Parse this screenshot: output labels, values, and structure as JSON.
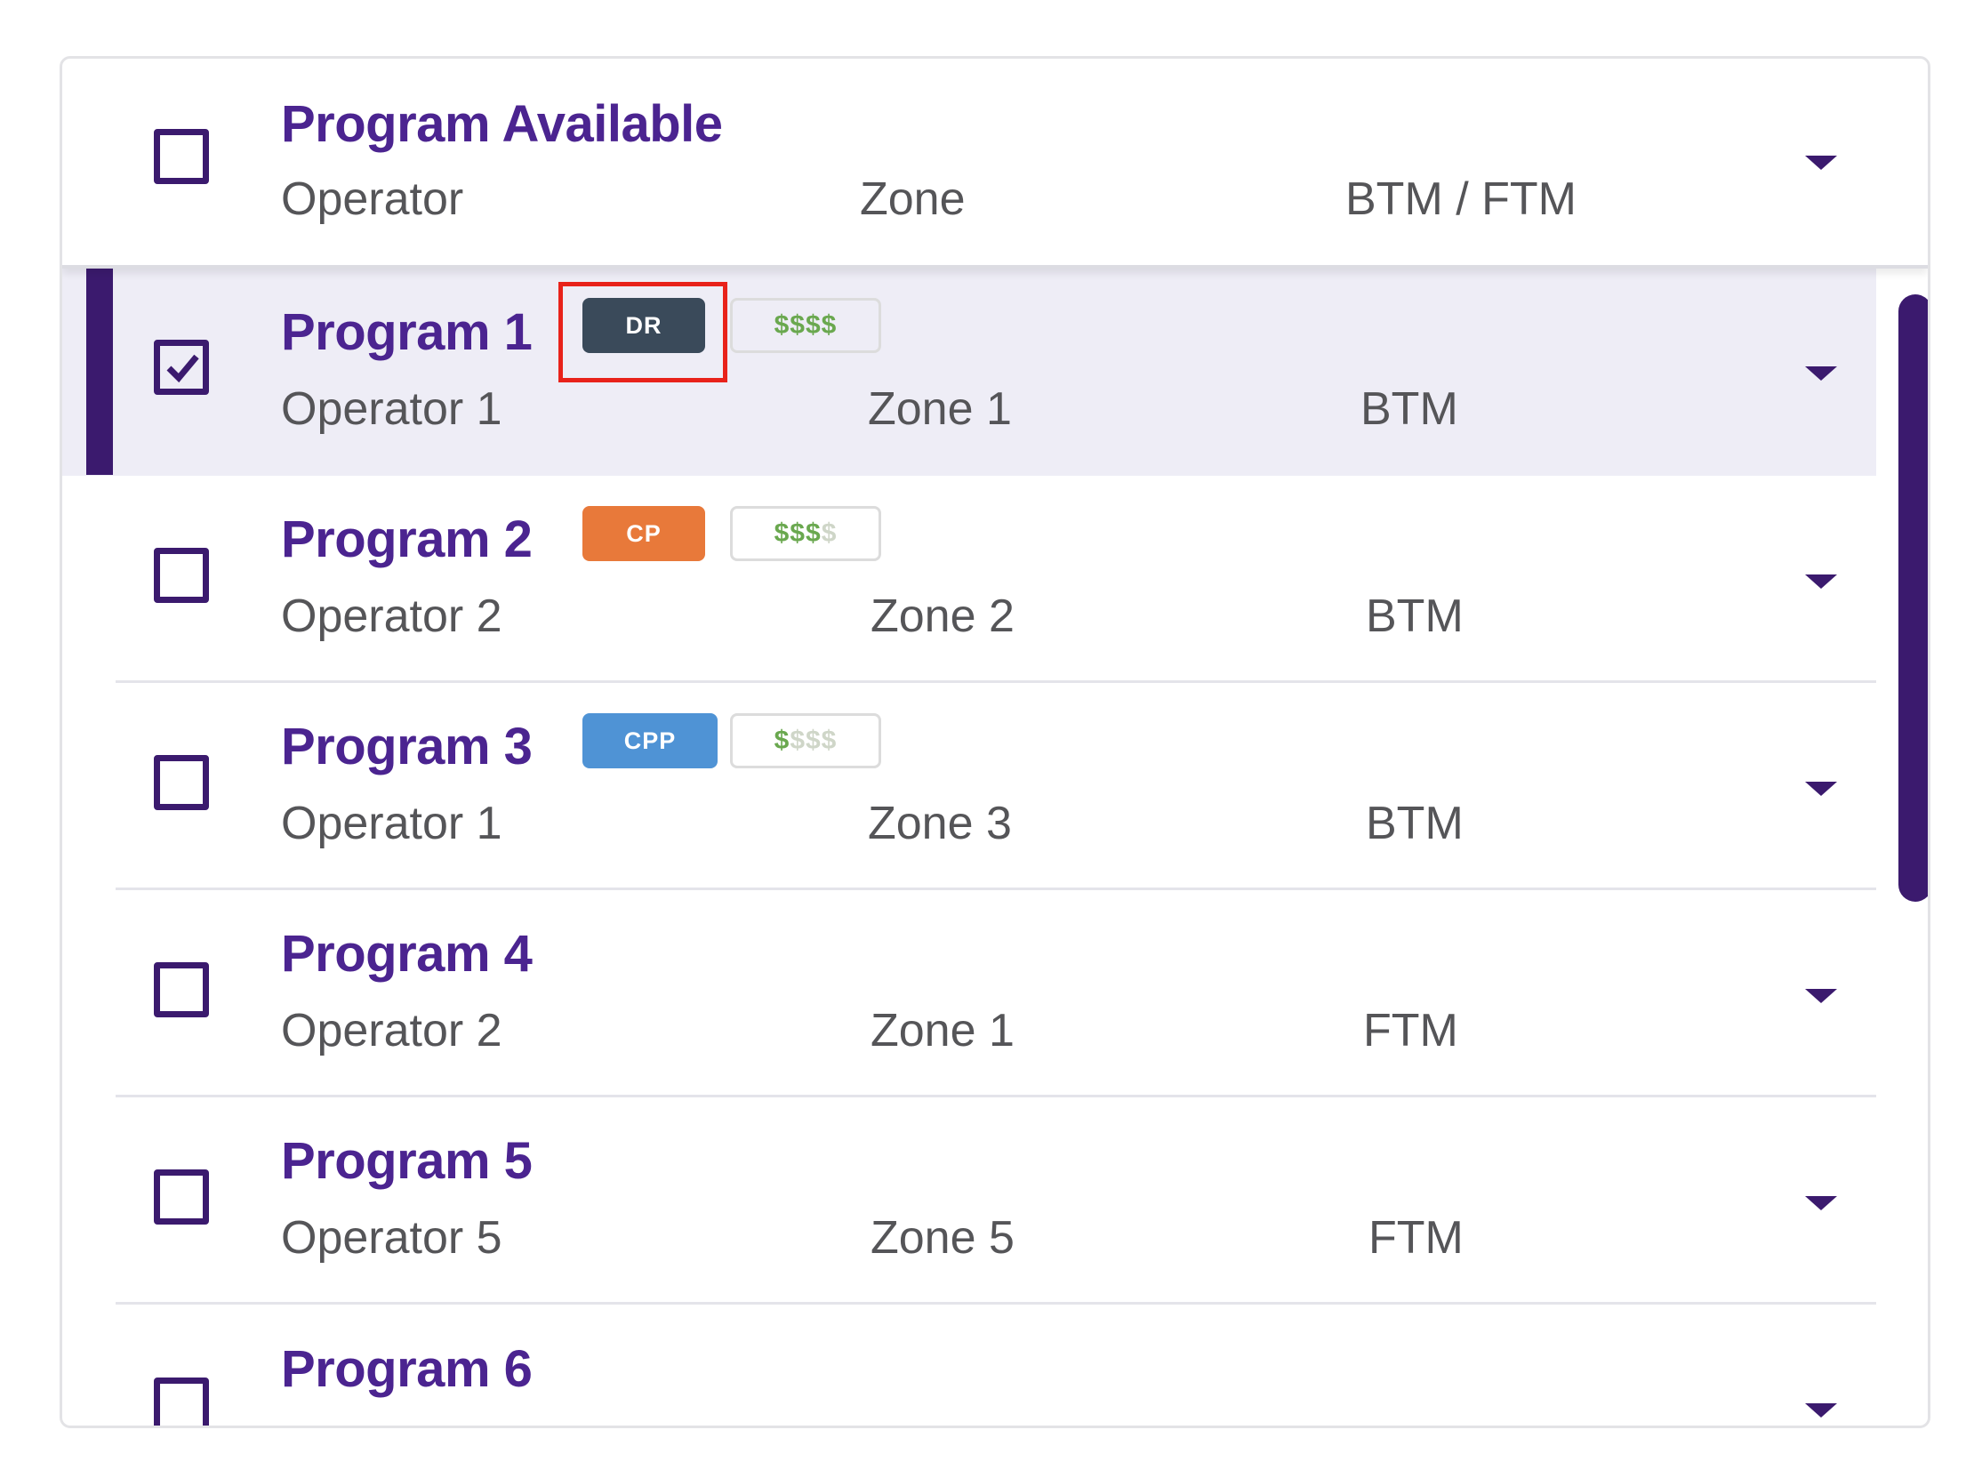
{
  "header": {
    "title": "Program Available",
    "columns": [
      "Operator",
      "Zone",
      "BTM / FTM"
    ],
    "checked": false
  },
  "rows": [
    {
      "title": "Program 1",
      "operator": "Operator 1",
      "zone": "Zone 1",
      "type": "BTM",
      "checked": true,
      "selected": true,
      "badge": {
        "label": "DR",
        "color": "#3a4a5a"
      },
      "price": {
        "symbols": "$$$$",
        "level": 4
      }
    },
    {
      "title": "Program 2",
      "operator": "Operator 2",
      "zone": "Zone 2",
      "type": "BTM",
      "checked": false,
      "badge": {
        "label": "CP",
        "color": "#e8793a"
      },
      "price": {
        "symbols": "$$$$",
        "level": 3
      }
    },
    {
      "title": "Program 3",
      "operator": "Operator 1",
      "zone": "Zone 3",
      "type": "BTM",
      "checked": false,
      "badge": {
        "label": "CPP",
        "color": "#4f93d5"
      },
      "price": {
        "symbols": "$$$$",
        "level": 1
      }
    },
    {
      "title": "Program 4",
      "operator": "Operator 2",
      "zone": "Zone 1",
      "type": "FTM",
      "checked": false
    },
    {
      "title": "Program 5",
      "operator": "Operator 5",
      "zone": "Zone 5",
      "type": "FTM",
      "checked": false
    },
    {
      "title": "Program 6",
      "operator": "",
      "zone": "",
      "type": "",
      "checked": false
    }
  ],
  "colors": {
    "accent": "#3b1a6e",
    "title": "#4b2490",
    "selected_bg": "#eeedf6",
    "highlight": "#e8221a"
  },
  "icons": {
    "checkbox": "checkbox-icon",
    "chevron": "chevron-down-icon"
  }
}
